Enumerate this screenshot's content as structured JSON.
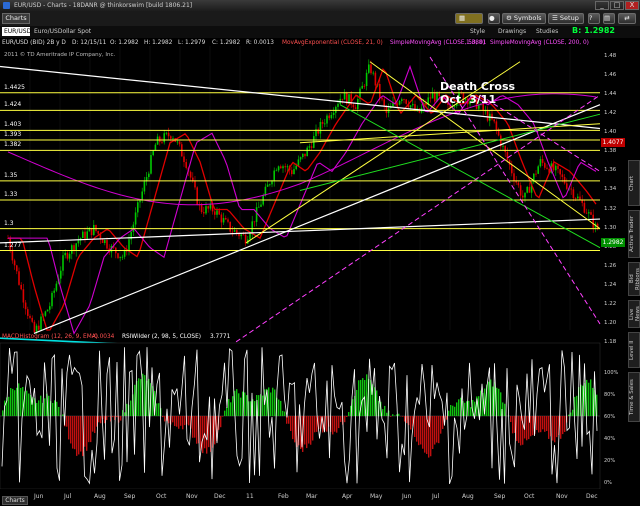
{
  "window": {
    "title": "EUR/USD - Charts - 18DANR @ thinkorswim [build 1806.21]",
    "minimize": "_",
    "maximize": "□",
    "close": "X"
  },
  "toolbar": {
    "tab": "Charts",
    "symbols": "Symbols",
    "setup": "Setup"
  },
  "symbar": {
    "symbol": "EUR/USD",
    "description": "Euro/USDollar Spot",
    "style": "Style",
    "drawings": "Drawings",
    "studies": "Studies"
  },
  "bid": "B: 1.2982",
  "quote": {
    "symbol": "EUR/USD (BID) 2B y D",
    "date": "D: 12/15/11",
    "open": "O: 1.2982",
    "high": "H: 1.2982",
    "low": "L: 1.2979",
    "close": "C: 1.2982",
    "change": "R: 0.0013",
    "ema": "MovAvgExponential (CLOSE, 21, 0)",
    "sma1": "SimpleMovingAvg (CLOSE, 50, 0)",
    "sma1_val": "1.3881",
    "sma2": "SimpleMovingAvg (CLOSE, 200, 0)"
  },
  "copyright": "2011 © TD Ameritrade IP Company, Inc.",
  "annotation": {
    "line1": "Death Cross",
    "line2": "Oct. 3/11"
  },
  "price_levels": [
    "1.4425",
    "1.424",
    "1.403",
    "1.393",
    "1.382",
    "1.35",
    "1.33",
    "1.3",
    "1.277"
  ],
  "y_axis": [
    "1.48",
    "1.46",
    "1.44",
    "1.42",
    "1.40",
    "1.38",
    "1.36",
    "1.34",
    "1.32",
    "1.30",
    "1.28",
    "1.26",
    "1.24",
    "1.22",
    "1.20",
    "1.18"
  ],
  "price_tags": [
    "1.4077",
    "1.2982"
  ],
  "x_axis": [
    "Jun",
    "Jul",
    "Aug",
    "Sep",
    "Oct",
    "Nov",
    "Dec",
    "11",
    "Feb",
    "Mar",
    "Apr",
    "May",
    "Jun",
    "Jul",
    "Aug",
    "Sep",
    "Oct",
    "Nov",
    "Dec"
  ],
  "indicators": {
    "macd": "MACDHistogram (12, 26, 9, EMA)",
    "macd_val": "-0.0034",
    "rsi": "RSIWilder (2, 98, 5, CLOSE)",
    "rsi_val": "3.7771"
  },
  "osc_axis": [
    "100%",
    "80%",
    "60%",
    "40%",
    "20%",
    "0%"
  ],
  "side_tabs": [
    "Chart",
    "Active Trader",
    "Bid Ribbons",
    "Live News",
    "Level II",
    "Time & Sales"
  ],
  "bottom_tab": "Charts",
  "colors": {
    "candle_up": "#00c800",
    "candle_down": "#e00000",
    "ema": "#e00000",
    "sma_magenta": "#d000d0",
    "trend_yellow": "#ffff40",
    "trend_white": "#ffffff",
    "trend_green": "#20e020",
    "trend_magenta_dash": "#ff40ff",
    "trend_cyan": "#00e0e0"
  }
}
